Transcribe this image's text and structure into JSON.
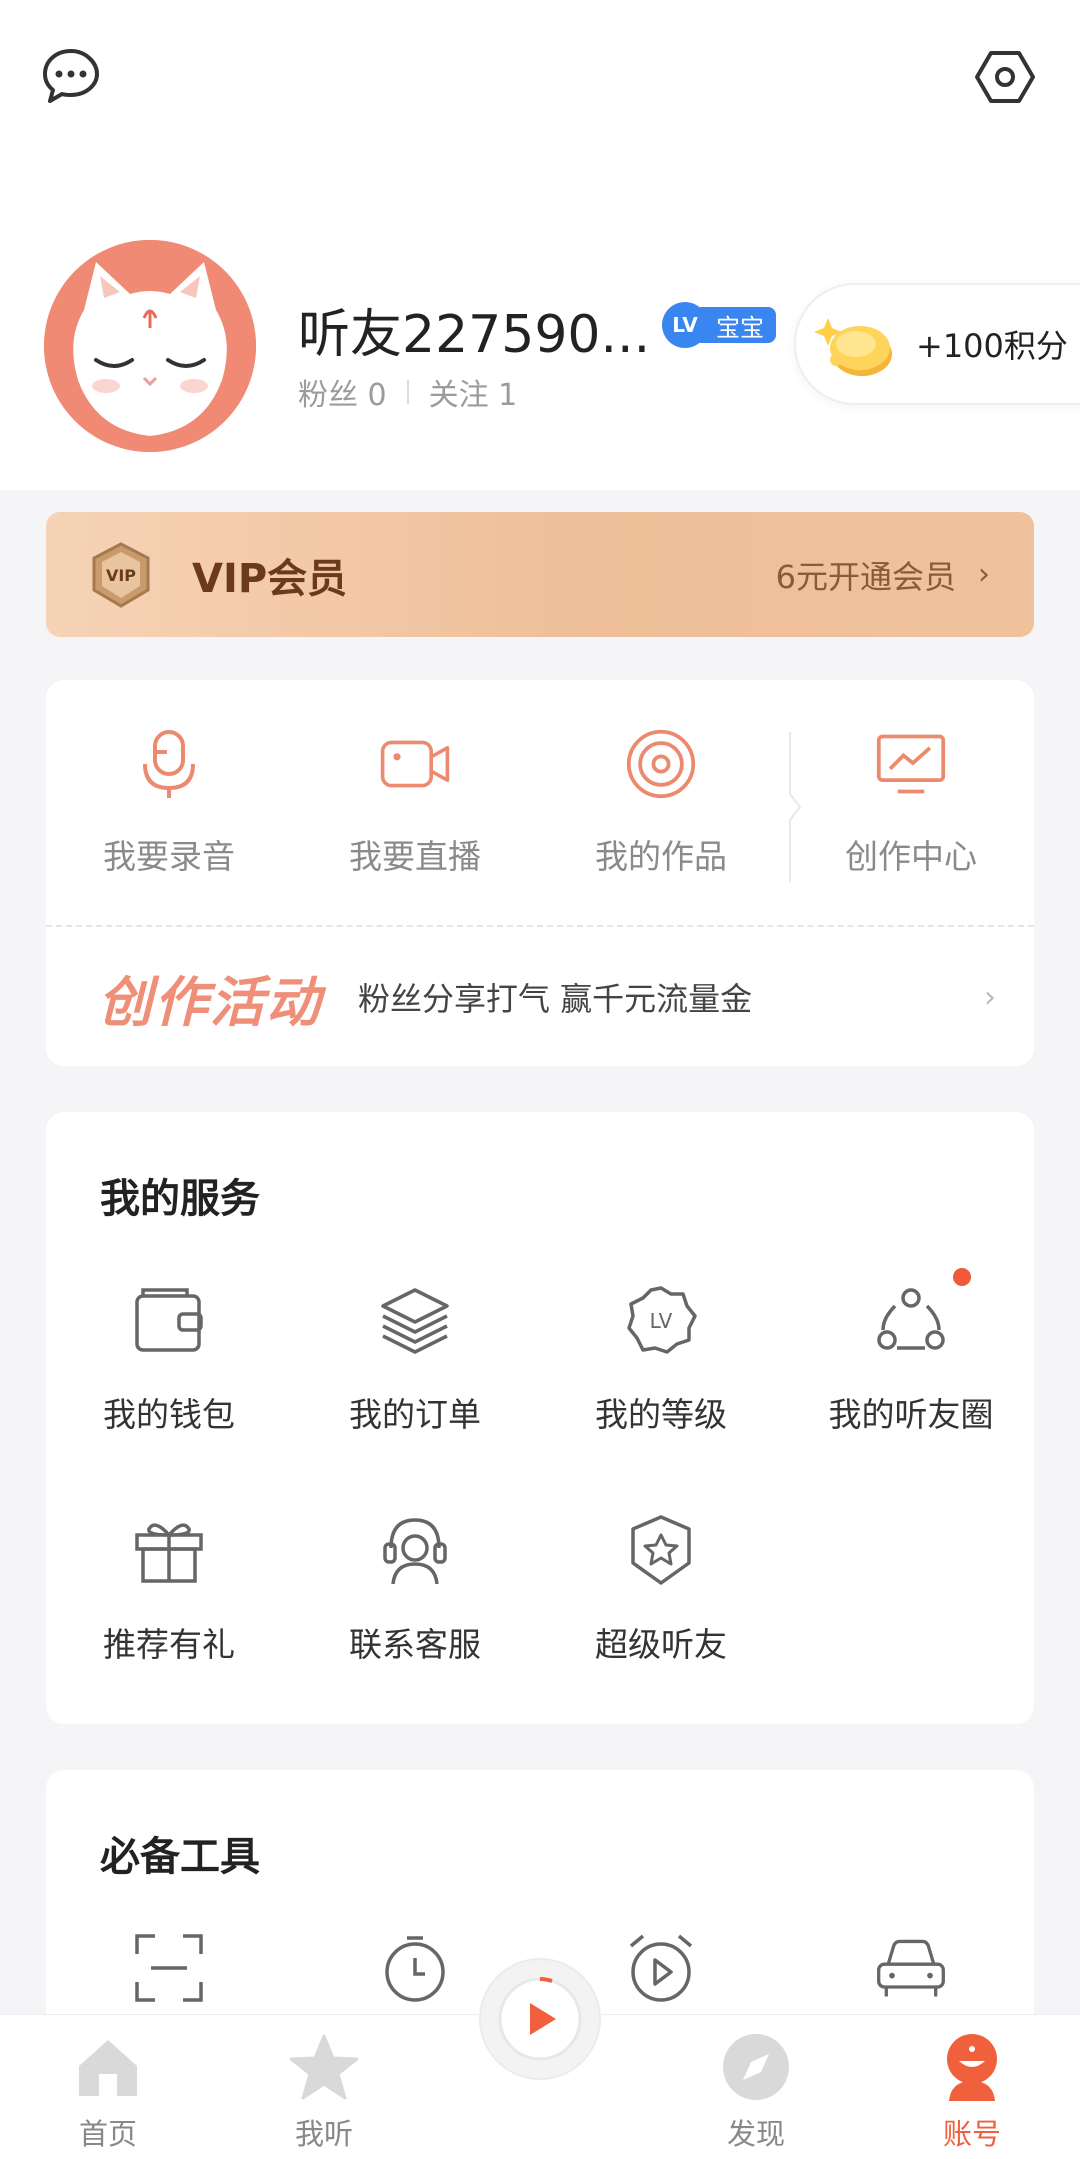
{
  "header": {
    "message_icon": "message-ellipsis-icon",
    "settings_icon": "hexagon-settings-icon"
  },
  "profile": {
    "username": "听友227590...",
    "level_badge_icon": "LV",
    "level_label": "宝宝",
    "fans": "粉丝 0",
    "following": "关注 1",
    "points": "+100积分"
  },
  "vip": {
    "badge_text": "VIP",
    "title": "VIP会员",
    "cta": "6元开通会员",
    "chevron": "›"
  },
  "create": {
    "items": [
      {
        "label": "我要录音",
        "icon": "microphone-icon"
      },
      {
        "label": "我要直播",
        "icon": "video-camera-icon"
      },
      {
        "label": "我的作品",
        "icon": "disc-icon"
      },
      {
        "label": "创作中心",
        "icon": "chart-monitor-icon"
      }
    ],
    "activity_title": "创作活动",
    "activity_desc": "粉丝分享打气 赢千元流量金",
    "chevron": "›"
  },
  "services": {
    "title": "我的服务",
    "items": [
      {
        "label": "我的钱包",
        "icon": "wallet-icon"
      },
      {
        "label": "我的订单",
        "icon": "layers-icon"
      },
      {
        "label": "我的等级",
        "icon": "level-badge-icon"
      },
      {
        "label": "我的听友圈",
        "icon": "community-icon"
      },
      {
        "label": "推荐有礼",
        "icon": "gift-icon"
      },
      {
        "label": "联系客服",
        "icon": "headset-icon"
      },
      {
        "label": "超级听友",
        "icon": "star-shield-icon"
      }
    ]
  },
  "tools": {
    "title": "必备工具",
    "items": [
      {
        "icon": "scan-icon"
      },
      {
        "icon": "timer-icon"
      },
      {
        "icon": "alarm-play-icon"
      },
      {
        "icon": "car-icon"
      }
    ]
  },
  "nav": {
    "items": [
      {
        "label": "首页",
        "icon": "home-icon"
      },
      {
        "label": "我听",
        "icon": "star-icon"
      },
      {
        "label": "发现",
        "icon": "compass-icon"
      },
      {
        "label": "账号",
        "icon": "account-icon"
      }
    ],
    "active": "账号"
  },
  "colors": {
    "accent": "#f0603c",
    "icon_orange": "#ec8a70",
    "vip_text": "#6b3a1c",
    "lv_blue": "#3a86f0"
  }
}
